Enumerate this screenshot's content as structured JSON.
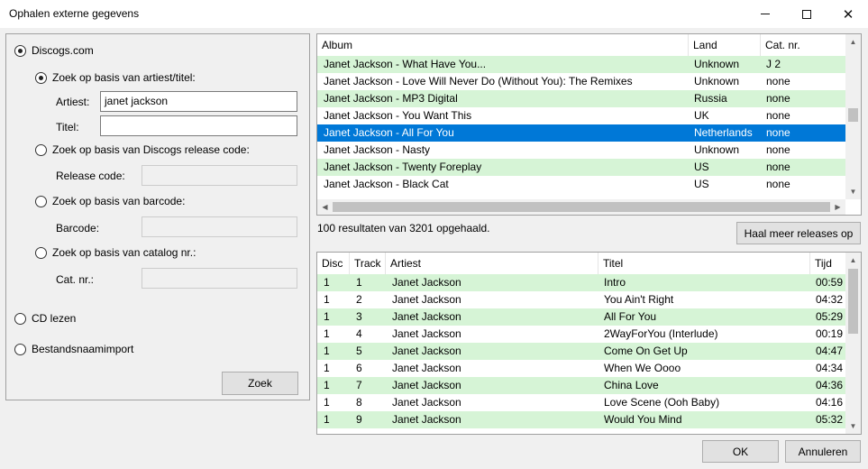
{
  "window": {
    "title": "Ophalen externe gegevens"
  },
  "source": {
    "discogs_label": "Discogs.com",
    "search_artist_title_label": "Zoek op basis van artiest/titel:",
    "artist_label": "Artiest:",
    "artist_value": "janet jackson",
    "title_label": "Titel:",
    "title_value": "",
    "search_release_code_label": "Zoek op basis van Discogs release code:",
    "release_code_label": "Release code:",
    "search_barcode_label": "Zoek op basis van barcode:",
    "barcode_label": "Barcode:",
    "search_catalog_label": "Zoek op basis van catalog nr.:",
    "catno_label": "Cat. nr.:",
    "cd_read_label": "CD lezen",
    "filename_import_label": "Bestandsnaamimport",
    "search_button": "Zoek"
  },
  "releases": {
    "columns": [
      "Album",
      "Land",
      "Cat. nr."
    ],
    "rows": [
      [
        "Janet Jackson - What Have You...",
        "Unknown",
        "J 2"
      ],
      [
        "Janet Jackson - Love Will Never Do (Without You): The Remixes",
        "Unknown",
        "none"
      ],
      [
        "Janet Jackson - MP3 Digital",
        "Russia",
        "none"
      ],
      [
        "Janet Jackson - You Want This",
        "UK",
        "none"
      ],
      [
        "Janet Jackson - All For You",
        "Netherlands",
        "none"
      ],
      [
        "Janet Jackson - Nasty",
        "Unknown",
        "none"
      ],
      [
        "Janet Jackson - Twenty Foreplay",
        "US",
        "none"
      ],
      [
        "Janet Jackson - Black Cat",
        "US",
        "none"
      ]
    ],
    "selected_index": 4,
    "status": "100 resultaten van 3201 opgehaald.",
    "more_button": "Haal meer releases op"
  },
  "tracks": {
    "columns": [
      "Disc",
      "Track",
      "Artiest",
      "Titel",
      "Tijd"
    ],
    "rows": [
      [
        "1",
        "1",
        "Janet Jackson",
        "Intro",
        "00:59"
      ],
      [
        "1",
        "2",
        "Janet Jackson",
        "You Ain't Right",
        "04:32"
      ],
      [
        "1",
        "3",
        "Janet Jackson",
        "All For You",
        "05:29"
      ],
      [
        "1",
        "4",
        "Janet Jackson",
        "2WayForYou (Interlude)",
        "00:19"
      ],
      [
        "1",
        "5",
        "Janet Jackson",
        "Come On Get Up",
        "04:47"
      ],
      [
        "1",
        "6",
        "Janet Jackson",
        "When We Oooo",
        "04:34"
      ],
      [
        "1",
        "7",
        "Janet Jackson",
        "China Love",
        "04:36"
      ],
      [
        "1",
        "8",
        "Janet Jackson",
        "Love Scene (Ooh Baby)",
        "04:16"
      ],
      [
        "1",
        "9",
        "Janet Jackson",
        "Would You Mind",
        "05:32"
      ]
    ]
  },
  "footer": {
    "ok_button": "OK",
    "cancel_button": "Annuleren"
  }
}
